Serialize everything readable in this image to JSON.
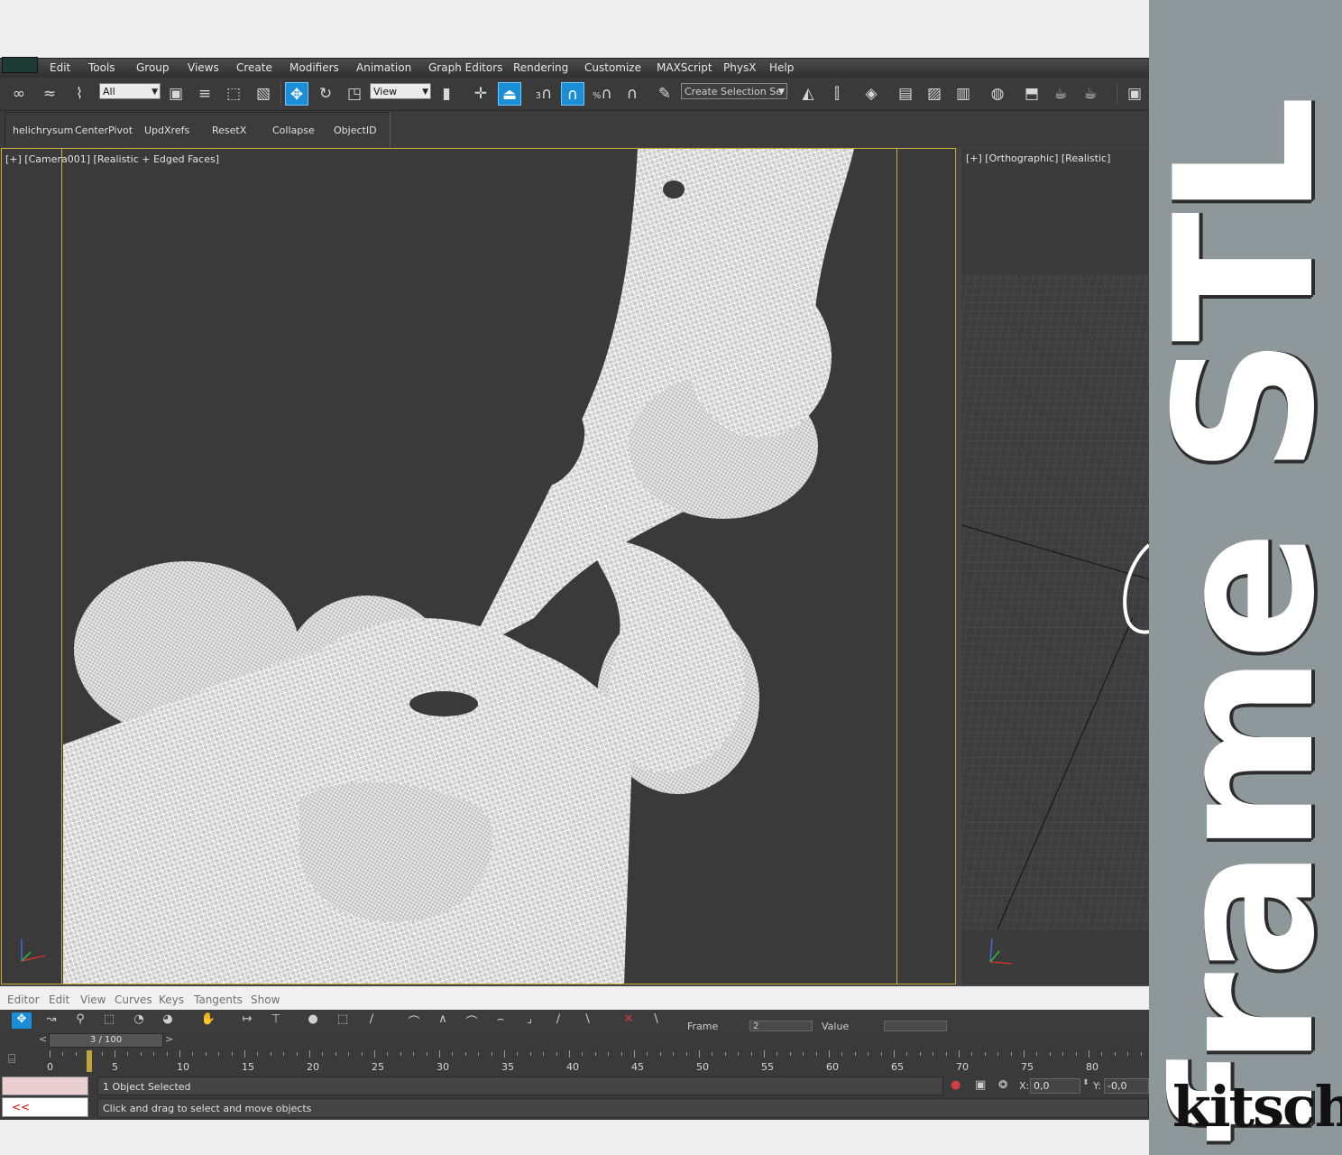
{
  "menu": {
    "items": [
      "Edit",
      "Tools",
      "Group",
      "Views",
      "Create",
      "Modifiers",
      "Animation",
      "Graph Editors",
      "Rendering",
      "Customize",
      "MAXScript",
      "PhysX",
      "Help"
    ]
  },
  "main_toolbar": {
    "selection_filter": "All",
    "reference_coord": "View",
    "named_selection_placeholder": "Create Selection Se",
    "snap_toggle_label": "3",
    "percent_snap_label": "%"
  },
  "script_toolbar": {
    "buttons": [
      "helichrysum",
      "CenterPivot",
      "UpdXrefs",
      "ResetX",
      "Collapse",
      "ObjectID"
    ]
  },
  "viewports": {
    "camera_label": "[+] [Camera001] [Realistic + Edged Faces]",
    "ortho_label": "[+] [Orthographic] [Realistic]"
  },
  "curve_editor": {
    "menus": [
      "Editor",
      "Edit",
      "View",
      "Curves",
      "Keys",
      "Tangents",
      "Show"
    ],
    "frame_label": "Frame",
    "frame_value": "2",
    "value_label": "Value"
  },
  "time_slider": {
    "position": "3 / 100",
    "prev": "<",
    "next": ">",
    "ticks": [
      "0",
      "5",
      "10",
      "15",
      "20",
      "25",
      "30",
      "35",
      "40",
      "45",
      "50",
      "55",
      "60",
      "65",
      "70",
      "75",
      "80"
    ]
  },
  "status": {
    "selection": "1 Object Selected",
    "prompt": "Click and drag to select and move objects",
    "listener_arrow": "<<",
    "x_label": "X:",
    "x_value": "0,0",
    "y_label": "Y:",
    "y_value": "-0,0"
  },
  "banner": {
    "wordmark": "frame STL",
    "brand": "kitsch",
    "background_color": "#8e9799"
  }
}
